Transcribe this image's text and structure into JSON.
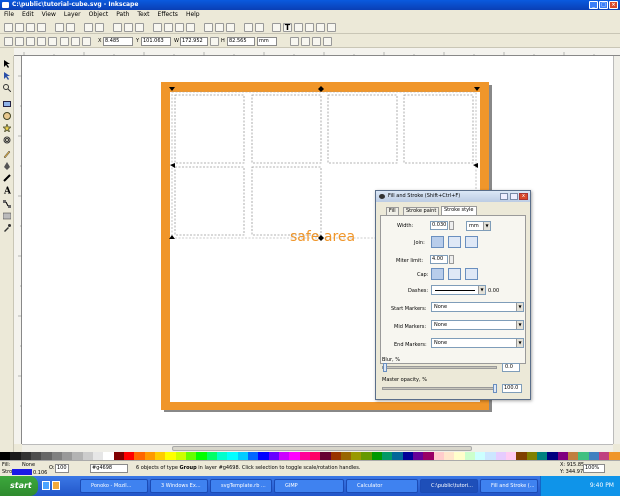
{
  "window": {
    "title": "C:\\public\\tutorial-cube.svg - Inkscape"
  },
  "menu": [
    "File",
    "Edit",
    "View",
    "Layer",
    "Object",
    "Path",
    "Text",
    "Effects",
    "Help"
  ],
  "controls": {
    "x_label": "X",
    "x_value": "8.485",
    "y_label": "Y",
    "y_value": "101.063",
    "w_label": "W",
    "w_value": "172.952",
    "h_label": "H",
    "h_value": "82.565",
    "unit": "mm"
  },
  "canvas": {
    "safe_area_text": "safe area",
    "accent_color": "#f0962a"
  },
  "dialog": {
    "title": "Fill and Stroke (Shift+Ctrl+F)",
    "tabs": [
      "Fill",
      "Stroke paint",
      "Stroke style"
    ],
    "width_label": "Width:",
    "width_value": "0.030",
    "width_unit": "mm",
    "join_label": "Join:",
    "miter_label": "Miter limit:",
    "miter_value": "4.00",
    "cap_label": "Cap:",
    "dashes_label": "Dashes:",
    "dashes_value": "0.00",
    "start_markers_label": "Start Markers:",
    "start_markers_value": "None",
    "mid_markers_label": "Mid Markers:",
    "mid_markers_value": "None",
    "end_markers_label": "End Markers:",
    "end_markers_value": "None",
    "blur_label": "Blur, %",
    "blur_value": "0.0",
    "opacity_label": "Master opacity, %",
    "opacity_value": "100.0"
  },
  "status": {
    "fill_label": "Fill:",
    "stroke_label": "Stroke:",
    "fill_value": "None",
    "stroke_value": "0.106",
    "opacity_label": "O:",
    "opacity_value": "100",
    "layer": "#g4698",
    "message_pre": "6 objects of type ",
    "message_bold": "Group",
    "message_post": " in layer #g4698. Click selection to toggle scale/rotation handles.",
    "x_coord": "X: 915.85",
    "y_coord": "Y: 344.97",
    "zoom": "100%"
  },
  "taskbar": {
    "start": "start",
    "tasks": [
      "Ponoko - Mozil...",
      "3 Windows Ex...",
      "svgTemplate.rb ...",
      "GIMP",
      "Calculator",
      "C:\\public\\tutori...",
      "Fill and Stroke (..."
    ],
    "clock": "9:40 PM"
  },
  "palette": [
    "#000000",
    "#1a1a1a",
    "#333333",
    "#4d4d4d",
    "#666666",
    "#808080",
    "#999999",
    "#b3b3b3",
    "#cccccc",
    "#e6e6e6",
    "#ffffff",
    "#800000",
    "#ff0000",
    "#ff6600",
    "#ff9900",
    "#ffcc00",
    "#ffff00",
    "#ccff00",
    "#66ff00",
    "#00ff00",
    "#00ff66",
    "#00ffcc",
    "#00ffff",
    "#00ccff",
    "#0066ff",
    "#0000ff",
    "#6600ff",
    "#cc00ff",
    "#ff00ff",
    "#ff0099",
    "#ff0066",
    "#660033",
    "#993300",
    "#996600",
    "#999900",
    "#669900",
    "#009900",
    "#009966",
    "#006699",
    "#000099",
    "#660099",
    "#990066",
    "#ffcccc",
    "#ffe6cc",
    "#ffffcc",
    "#ccffcc",
    "#ccffff",
    "#cce6ff",
    "#e6ccff",
    "#ffccf2",
    "#804000",
    "#808000",
    "#008080",
    "#000080",
    "#800080",
    "#c08040",
    "#40c080",
    "#4080c0",
    "#c04080",
    "#f0962a"
  ]
}
